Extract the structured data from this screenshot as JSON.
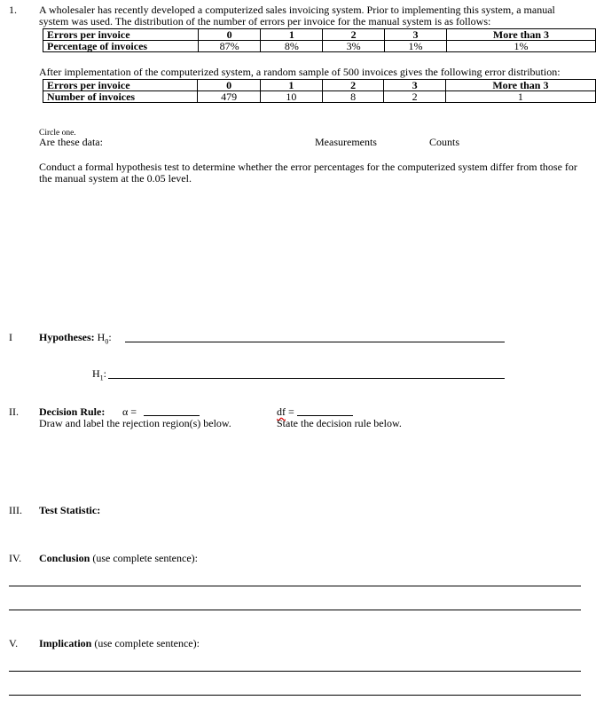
{
  "question": {
    "number": "1.",
    "intro_line1": "A wholesaler has recently developed a computerized sales invoicing system. Prior to implementing this system, a manual",
    "intro_line2": "system was used. The distribution of the number of errors per invoice for the manual system is as follows:",
    "table1": {
      "header_label": "Errors per invoice",
      "row_label": "Percentage of invoices",
      "columns": [
        "0",
        "1",
        "2",
        "3",
        "More than 3"
      ],
      "values": [
        "87%",
        "8%",
        "3%",
        "1%",
        "1%"
      ]
    },
    "after_text": "After implementation of the computerized system, a random sample of 500 invoices gives the following error distribution:",
    "table2": {
      "header_label": "Errors per invoice",
      "row_label": "Number of invoices",
      "columns": [
        "0",
        "1",
        "2",
        "3",
        "More than 3"
      ],
      "values": [
        "479",
        "10",
        "8",
        "2",
        "1"
      ]
    },
    "circle_one": "Circle one.",
    "data_type_prompt": "Are these data:",
    "option_measurements": "Measurements",
    "option_counts": "Counts",
    "task_line1": "Conduct a formal hypothesis test to determine whether the error percentages for the computerized system differ from those for",
    "task_line2": "the manual system at the 0.05 level."
  },
  "sections": {
    "hypotheses": {
      "numeral": "I",
      "label": "Hypotheses:",
      "h0_label": "H",
      "h0_sub": "0",
      "h1_label": "H",
      "h1_sub": "1",
      "colon": ":"
    },
    "decision_rule": {
      "numeral": "II.",
      "label": "Decision Rule:",
      "alpha_label": "α =",
      "df_label": "df",
      "df_eq": " =",
      "draw_instruction": "Draw and label the rejection region(s) below.",
      "state_instruction": "State the decision rule below."
    },
    "test_statistic": {
      "numeral": "III.",
      "label": "Test Statistic:"
    },
    "conclusion": {
      "numeral": "IV.",
      "label": "Conclusion",
      "note": " (use complete sentence):"
    },
    "implication": {
      "numeral": "V.",
      "label": "Implication",
      "note": " (use complete sentence):"
    }
  }
}
